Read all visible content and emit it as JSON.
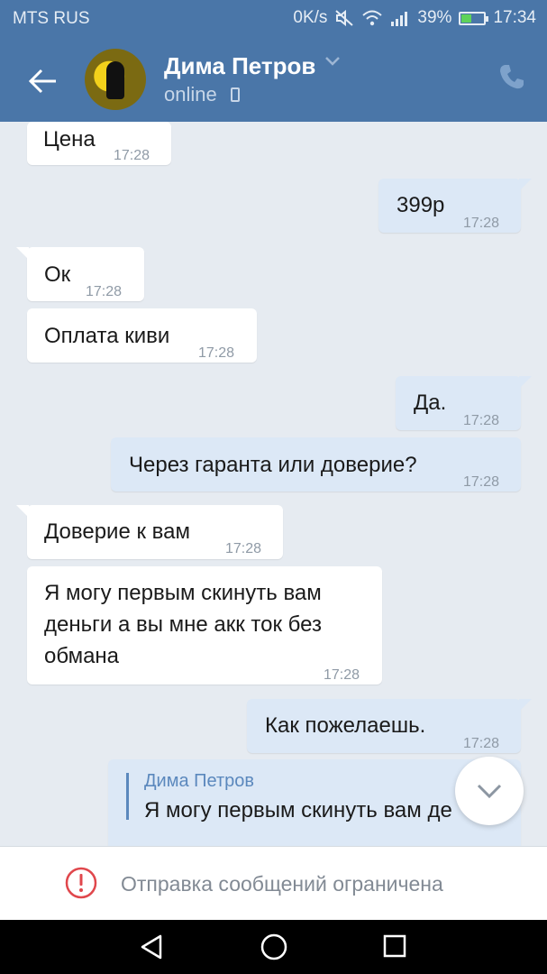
{
  "status_bar": {
    "carrier": "MTS RUS",
    "speed": "0K/s",
    "battery": "39%",
    "battery_level": 0.39,
    "time": "17:34"
  },
  "header": {
    "name": "Дима Петров",
    "status": "online"
  },
  "messages": [
    {
      "dir": "in",
      "text": "Цена",
      "time": "17:28"
    },
    {
      "dir": "out",
      "text": "399р",
      "time": "17:28"
    },
    {
      "dir": "in",
      "text": "Ок",
      "time": "17:28"
    },
    {
      "dir": "in",
      "text": "Оплата киви",
      "time": "17:28"
    },
    {
      "dir": "out",
      "text": "Да.",
      "time": "17:28"
    },
    {
      "dir": "out",
      "text": "Через гаранта или доверие?",
      "time": "17:28"
    },
    {
      "dir": "in",
      "text": "Доверие к вам",
      "time": "17:28"
    },
    {
      "dir": "in",
      "text_lines": [
        "Я могу первым скинуть вам",
        "деньги а вы мне акк ток без",
        "обмана"
      ],
      "time": "17:28"
    },
    {
      "dir": "out",
      "text": "Как пожелаешь.",
      "time": "17:28"
    }
  ],
  "reply": {
    "name": "Дима Петров",
    "text": "Я могу первым скинуть вам де"
  },
  "bottom": {
    "restriction": "Отправка сообщений ограничена"
  },
  "colors": {
    "header": "#4a76a8",
    "chat_bg": "#e6ebf1",
    "bubble_in": "#ffffff",
    "bubble_out": "#dce8f6",
    "accent": "#5b88bd",
    "warning": "#e0474c"
  },
  "icons": [
    "back-arrow-icon",
    "chevron-down-icon",
    "mobile-icon",
    "phone-icon",
    "warning-icon",
    "nav-back-icon",
    "nav-home-icon",
    "nav-recent-icon"
  ]
}
